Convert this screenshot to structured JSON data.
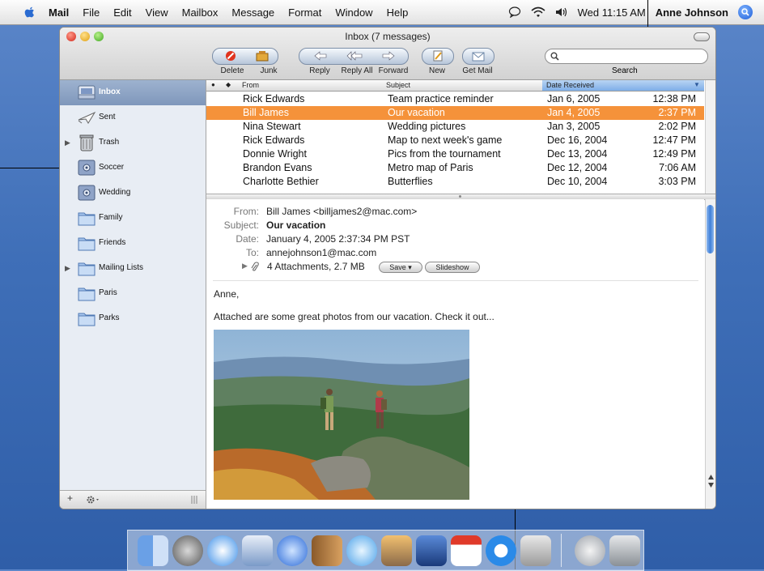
{
  "menubar": {
    "app": "Mail",
    "items": [
      "File",
      "Edit",
      "View",
      "Mailbox",
      "Message",
      "Format",
      "Window",
      "Help"
    ],
    "clock": "Wed 11:15 AM",
    "user": "Anne Johnson"
  },
  "window": {
    "title": "Inbox (7 messages)",
    "toolbar": {
      "delete": "Delete",
      "junk": "Junk",
      "reply": "Reply",
      "reply_all": "Reply All",
      "forward": "Forward",
      "new": "New",
      "get_mail": "Get Mail",
      "search": "Search"
    }
  },
  "sidebar": {
    "items": [
      {
        "label": "Inbox",
        "icon": "inbox-icon",
        "selected": true
      },
      {
        "label": "Sent",
        "icon": "sent-icon"
      },
      {
        "label": "Trash",
        "icon": "trash-icon"
      },
      {
        "label": "Soccer",
        "icon": "smart-mailbox-icon"
      },
      {
        "label": "Wedding",
        "icon": "smart-mailbox-icon"
      },
      {
        "label": "Family",
        "icon": "folder-icon"
      },
      {
        "label": "Friends",
        "icon": "folder-icon"
      },
      {
        "label": "Mailing Lists",
        "icon": "folder-icon"
      },
      {
        "label": "Paris",
        "icon": "folder-icon"
      },
      {
        "label": "Parks",
        "icon": "folder-icon"
      }
    ],
    "footer": {
      "add": "+"
    }
  },
  "list": {
    "headers": {
      "from": "From",
      "subject": "Subject",
      "date": "Date Received"
    },
    "rows": [
      {
        "from": "Rick Edwards",
        "subject": "Team practice reminder",
        "date": "Jan 6, 2005",
        "time": "12:38 PM"
      },
      {
        "from": "Bill James",
        "subject": "Our vacation",
        "date": "Jan 4, 2005",
        "time": "2:37 PM"
      },
      {
        "from": "Nina Stewart",
        "subject": "Wedding pictures",
        "date": "Jan 3, 2005",
        "time": "2:02 PM"
      },
      {
        "from": "Rick Edwards",
        "subject": "Map to next week's game",
        "date": "Dec 16, 2004",
        "time": "12:47 PM"
      },
      {
        "from": "Donnie Wright",
        "subject": "Pics from the tournament",
        "date": "Dec 13, 2004",
        "time": "12:49 PM"
      },
      {
        "from": "Brandon Evans",
        "subject": "Metro map of Paris",
        "date": "Dec 12, 2004",
        "time": "7:06 AM"
      },
      {
        "from": "Charlotte Bethier",
        "subject": "Butterflies",
        "date": "Dec 10, 2004",
        "time": "3:03 PM"
      }
    ]
  },
  "message": {
    "from_label": "From:",
    "from": "Bill James <billjames2@mac.com>",
    "subject_label": "Subject:",
    "subject": "Our vacation",
    "date_label": "Date:",
    "date": "January 4, 2005 2:37:34 PM PST",
    "to_label": "To:",
    "to": "annejohnson1@mac.com",
    "attachments": "4 Attachments, 2.7 MB",
    "save": "Save",
    "slideshow": "Slideshow",
    "greeting": "Anne,",
    "body": "Attached are some great photos from our vacation. Check it out..."
  },
  "colors": {
    "selection": "#f5923a",
    "sidebar_selection": "#8ea4c6",
    "desktop": "#3f6fb8"
  }
}
